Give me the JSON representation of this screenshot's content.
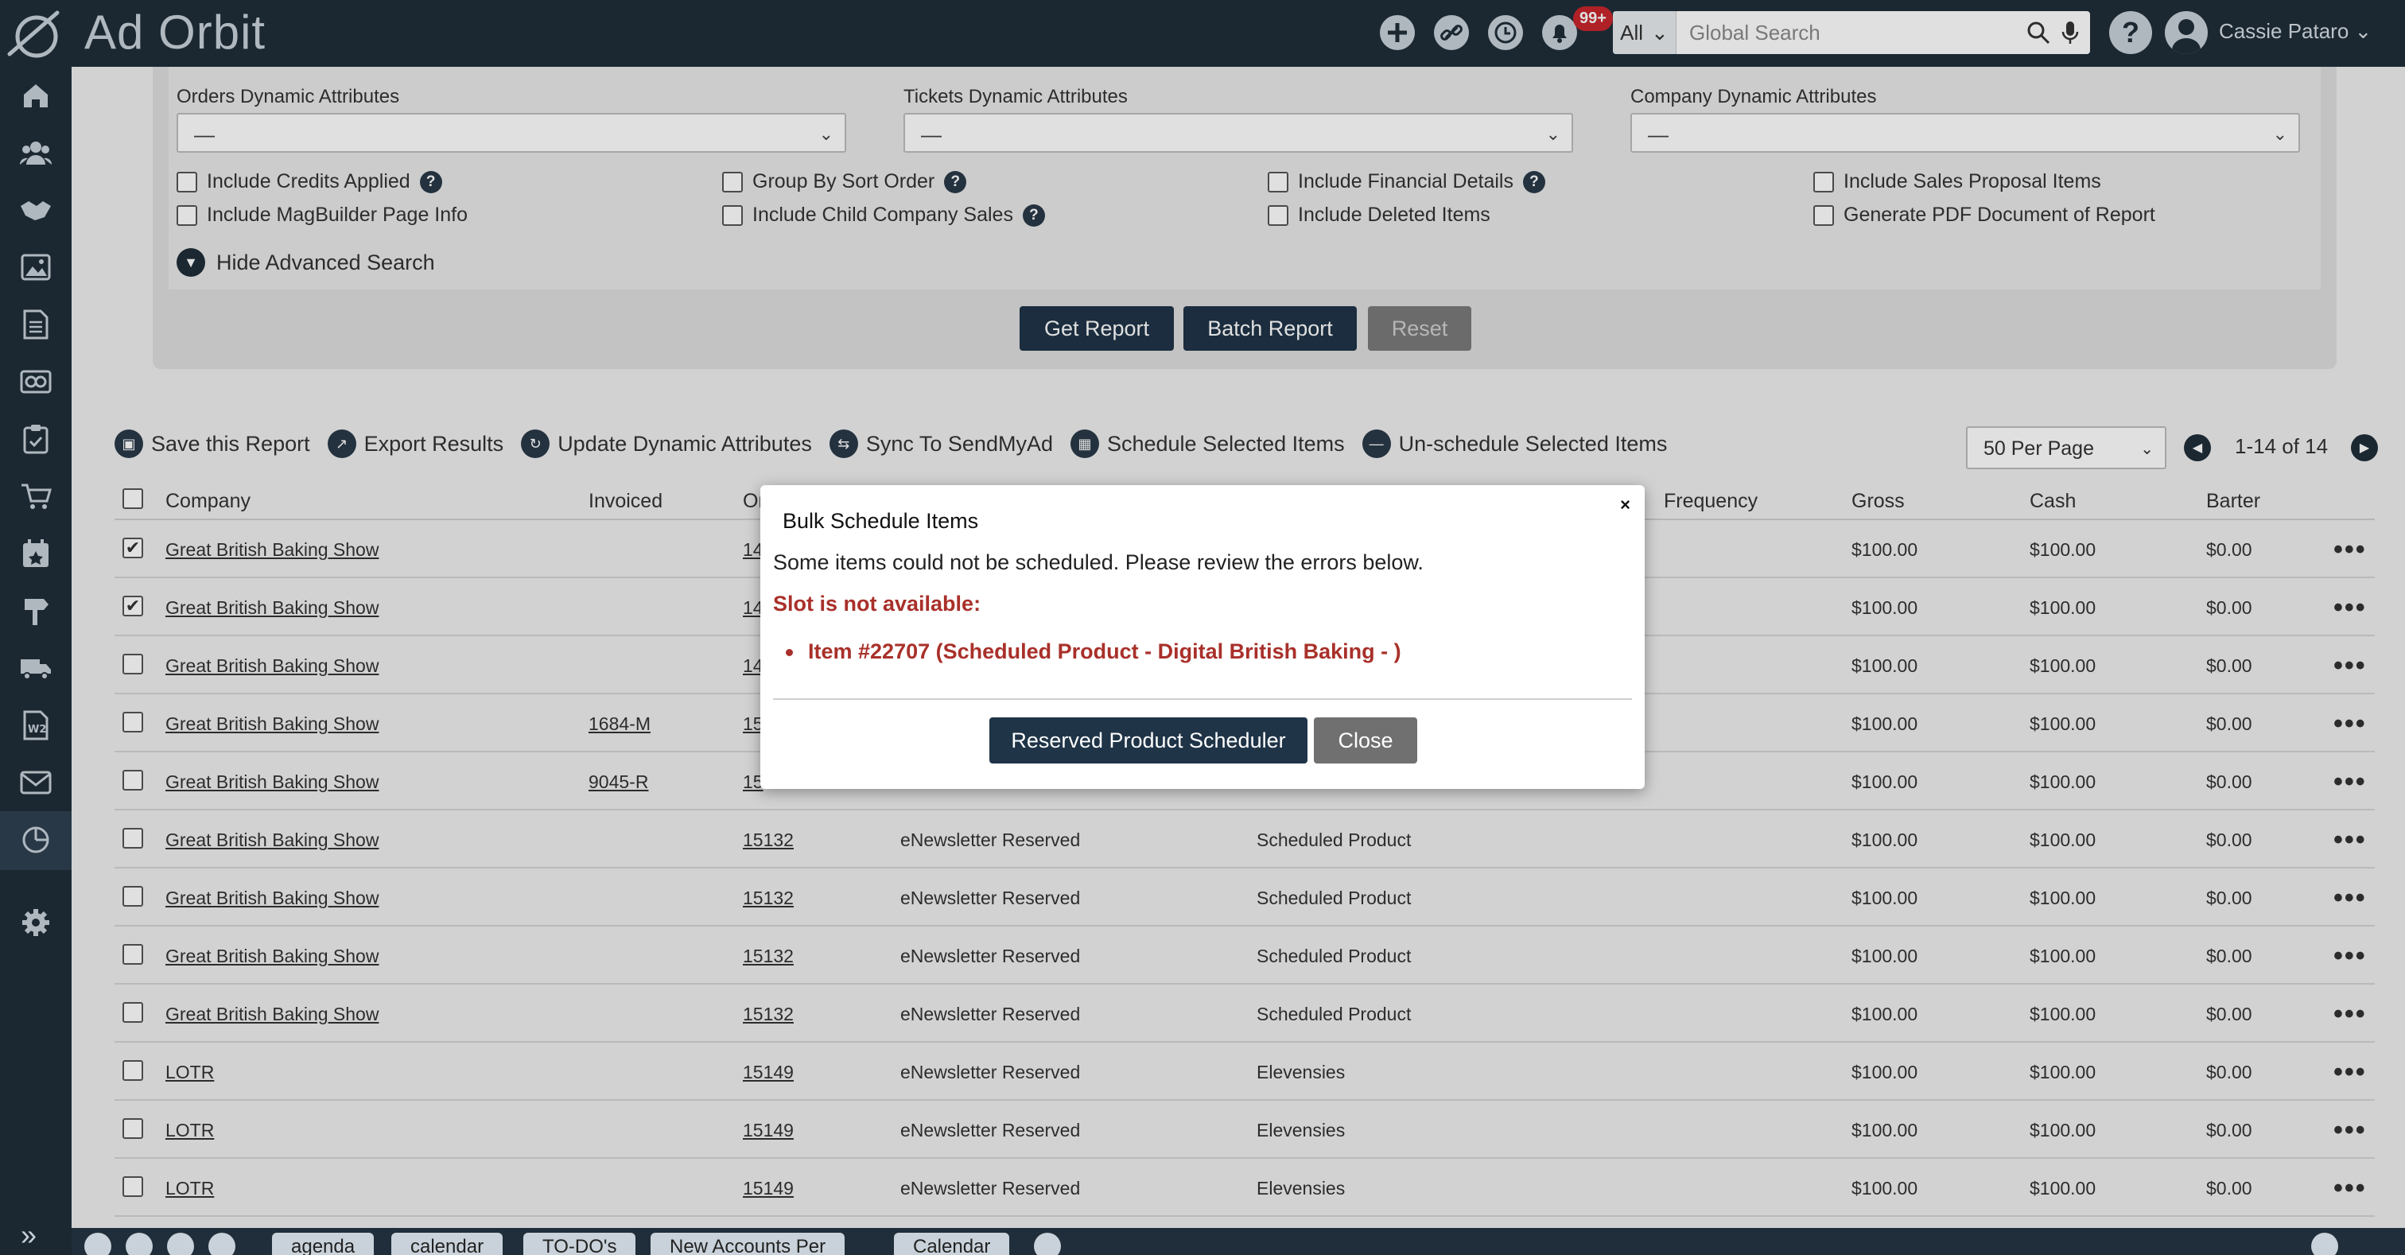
{
  "app": {
    "brand": "Ad Orbit",
    "search": {
      "scope": "All",
      "placeholder": "Global Search"
    },
    "notifications_badge": "99+",
    "user_name": "Cassie Pataro",
    "accent": "#1f2e3a"
  },
  "filters": {
    "orders_label": "Orders Dynamic Attributes",
    "orders_value": "—",
    "tickets_label": "Tickets Dynamic Attributes",
    "tickets_value": "—",
    "company_label": "Company Dynamic Attributes",
    "company_value": "—",
    "checkboxes": [
      {
        "label": "Include Credits Applied",
        "checked": false,
        "help": true
      },
      {
        "label": "Include MagBuilder Page Info",
        "checked": false,
        "help": false
      },
      {
        "label": "Group By Sort Order",
        "checked": false,
        "help": true
      },
      {
        "label": "Include Child Company Sales",
        "checked": false,
        "help": true
      },
      {
        "label": "Include Financial Details",
        "checked": false,
        "help": true
      },
      {
        "label": "Include Deleted Items",
        "checked": false,
        "help": false
      },
      {
        "label": "Include Sales Proposal Items",
        "checked": false,
        "help": false
      },
      {
        "label": "Generate PDF Document of Report",
        "checked": false,
        "help": false
      }
    ],
    "hide_advanced": "Hide Advanced Search",
    "buttons": {
      "get_report": "Get Report",
      "batch_report": "Batch Report",
      "reset": "Reset"
    }
  },
  "toolbar": {
    "save": "Save this Report",
    "export": "Export Results",
    "update_attrs": "Update Dynamic Attributes",
    "sync": "Sync To SendMyAd",
    "schedule": "Schedule Selected Items",
    "unschedule": "Un-schedule Selected Items",
    "per_page": "50 Per Page",
    "pager": "1-14 of 14"
  },
  "table": {
    "headers": {
      "company": "Company",
      "invoiced": "Invoiced",
      "order": "Or",
      "frequency": "Frequency",
      "gross": "Gross",
      "cash": "Cash",
      "barter": "Barter"
    },
    "rows": [
      {
        "checked": true,
        "company": "Great British Baking Show",
        "invoiced": "",
        "order": "14",
        "product": "",
        "item": "",
        "gross": "$100.00",
        "cash": "$100.00",
        "barter": "$0.00"
      },
      {
        "checked": true,
        "company": "Great British Baking Show",
        "invoiced": "",
        "order": "14",
        "product": "",
        "item": "",
        "gross": "$100.00",
        "cash": "$100.00",
        "barter": "$0.00"
      },
      {
        "checked": false,
        "company": "Great British Baking Show",
        "invoiced": "",
        "order": "14",
        "product": "",
        "item": "",
        "gross": "$100.00",
        "cash": "$100.00",
        "barter": "$0.00"
      },
      {
        "checked": false,
        "company": "Great British Baking Show",
        "invoiced": "1684-M",
        "order": "15",
        "product": "",
        "item": "",
        "gross": "$100.00",
        "cash": "$100.00",
        "barter": "$0.00"
      },
      {
        "checked": false,
        "company": "Great British Baking Show",
        "invoiced": "9045-R",
        "order": "15",
        "product": "",
        "item": "",
        "gross": "$100.00",
        "cash": "$100.00",
        "barter": "$0.00"
      },
      {
        "checked": false,
        "company": "Great British Baking Show",
        "invoiced": "",
        "order": "15132",
        "product": "eNewsletter Reserved",
        "item": "Scheduled Product",
        "gross": "$100.00",
        "cash": "$100.00",
        "barter": "$0.00"
      },
      {
        "checked": false,
        "company": "Great British Baking Show",
        "invoiced": "",
        "order": "15132",
        "product": "eNewsletter Reserved",
        "item": "Scheduled Product",
        "gross": "$100.00",
        "cash": "$100.00",
        "barter": "$0.00"
      },
      {
        "checked": false,
        "company": "Great British Baking Show",
        "invoiced": "",
        "order": "15132",
        "product": "eNewsletter Reserved",
        "item": "Scheduled Product",
        "gross": "$100.00",
        "cash": "$100.00",
        "barter": "$0.00"
      },
      {
        "checked": false,
        "company": "Great British Baking Show",
        "invoiced": "",
        "order": "15132",
        "product": "eNewsletter Reserved",
        "item": "Scheduled Product",
        "gross": "$100.00",
        "cash": "$100.00",
        "barter": "$0.00"
      },
      {
        "checked": false,
        "company": "LOTR",
        "invoiced": "",
        "order": "15149",
        "product": "eNewsletter Reserved",
        "item": "Elevensies",
        "gross": "$100.00",
        "cash": "$100.00",
        "barter": "$0.00"
      },
      {
        "checked": false,
        "company": "LOTR",
        "invoiced": "",
        "order": "15149",
        "product": "eNewsletter Reserved",
        "item": "Elevensies",
        "gross": "$100.00",
        "cash": "$100.00",
        "barter": "$0.00"
      },
      {
        "checked": false,
        "company": "LOTR",
        "invoiced": "",
        "order": "15149",
        "product": "eNewsletter Reserved",
        "item": "Elevensies",
        "gross": "$100.00",
        "cash": "$100.00",
        "barter": "$0.00"
      }
    ]
  },
  "modal": {
    "title": "Bulk Schedule Items",
    "message": "Some items could not be scheduled. Please review the errors below.",
    "error_heading": "Slot is not available:",
    "error_item": "Item #22707 (Scheduled Product - Digital British Baking - )",
    "primary_button": "Reserved Product Scheduler",
    "close_button": "Close",
    "close_x": "×",
    "error_color": "#a9302a"
  },
  "bottom_tabs": [
    "agenda",
    "calendar",
    "TO-DO's",
    "New Accounts Per",
    "Calendar"
  ]
}
